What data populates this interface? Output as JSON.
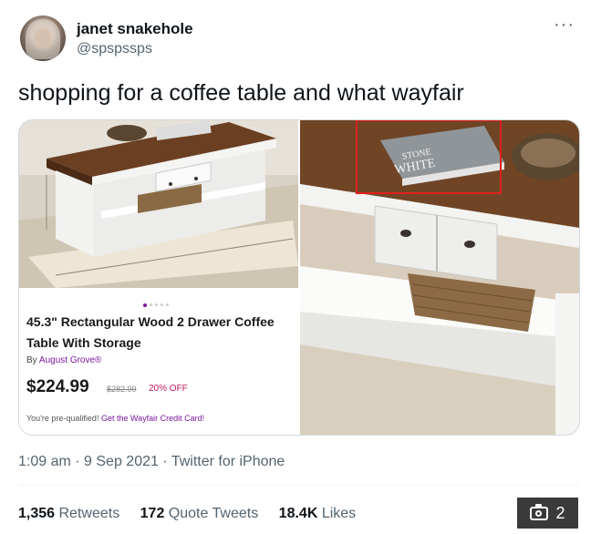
{
  "author": {
    "name": "janet snakehole",
    "handle": "@spspssps"
  },
  "more_label": "···",
  "tweet_text": "shopping for a coffee table and what wayfair",
  "product": {
    "title": "45.3\" Rectangular Wood 2 Drawer Coffee Table With Storage",
    "brand_prefix": "By ",
    "brand_name": "August Grove®",
    "price": "$224.99",
    "was_price": "$282.99",
    "discount": "20% OFF",
    "qualified_text": "You're pre-qualified!",
    "credit_link": "Get the Wayfair Credit Card!"
  },
  "book_text": {
    "top": "STONE",
    "middle": "WHITE"
  },
  "timestamp": "1:09 am · 9 Sep 2021 · Twitter for iPhone",
  "stats": {
    "retweets_count": "1,356",
    "retweets_label": " Retweets",
    "quotes_count": "172",
    "quotes_label": " Quote Tweets",
    "likes_count": "18.4K",
    "likes_label": " Likes"
  },
  "photo_count": "2",
  "colors": {
    "wayfair_purple": "#7b189f",
    "highlight_red": "#e0201e",
    "discount": "#c0185c"
  },
  "icons": {
    "more": "more-icon",
    "photo": "camera-icon"
  }
}
